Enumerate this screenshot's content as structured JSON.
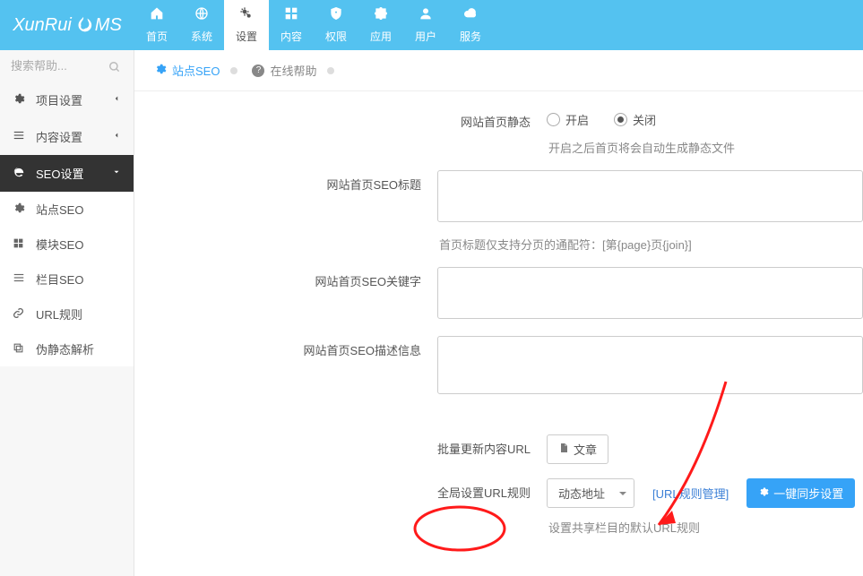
{
  "logo": {
    "part1": "XunRui",
    "part2": "MS"
  },
  "topnav": [
    {
      "icon": "home",
      "label": "首页"
    },
    {
      "icon": "globe",
      "label": "系统"
    },
    {
      "icon": "gears",
      "label": "设置",
      "active": true
    },
    {
      "icon": "grid",
      "label": "内容"
    },
    {
      "icon": "shield",
      "label": "权限"
    },
    {
      "icon": "puzzle",
      "label": "应用"
    },
    {
      "icon": "user",
      "label": "用户"
    },
    {
      "icon": "cloud",
      "label": "服务"
    }
  ],
  "search": {
    "placeholder": "搜索帮助..."
  },
  "menu": {
    "groups": [
      {
        "icon": "gear",
        "label": "项目设置",
        "expanded": false
      },
      {
        "icon": "list",
        "label": "内容设置",
        "expanded": false
      },
      {
        "icon": "ie",
        "label": "SEO设置",
        "expanded": true,
        "active": true
      }
    ],
    "sub": [
      {
        "icon": "gear",
        "label": "站点SEO",
        "selected": true
      },
      {
        "icon": "grid4",
        "label": "模块SEO"
      },
      {
        "icon": "list",
        "label": "栏目SEO"
      },
      {
        "icon": "link",
        "label": "URL规则"
      },
      {
        "icon": "clone",
        "label": "伪静态解析"
      }
    ]
  },
  "tabs": {
    "active_label": "站点SEO",
    "help_label": "在线帮助"
  },
  "form": {
    "row_static_label": "网站首页静态",
    "radio_open": "开启",
    "radio_close": "关闭",
    "static_help": "开启之后首页将会自动生成静态文件",
    "row_title_label": "网站首页SEO标题",
    "title_help": "首页标题仅支持分页的通配符：[第{page}页{join}]",
    "row_keywords_label": "网站首页SEO关键字",
    "row_desc_label": "网站首页SEO描述信息",
    "row_batch_label": "批量更新内容URL",
    "batch_button": "文章",
    "row_global_label": "全局设置URL规则",
    "global_select": "动态地址",
    "global_link": "[URL规则管理]",
    "global_sync_button": "一键同步设置",
    "global_help": "设置共享栏目的默认URL规则",
    "seo_title_value": "",
    "seo_keywords_value": "",
    "seo_desc_value": ""
  }
}
